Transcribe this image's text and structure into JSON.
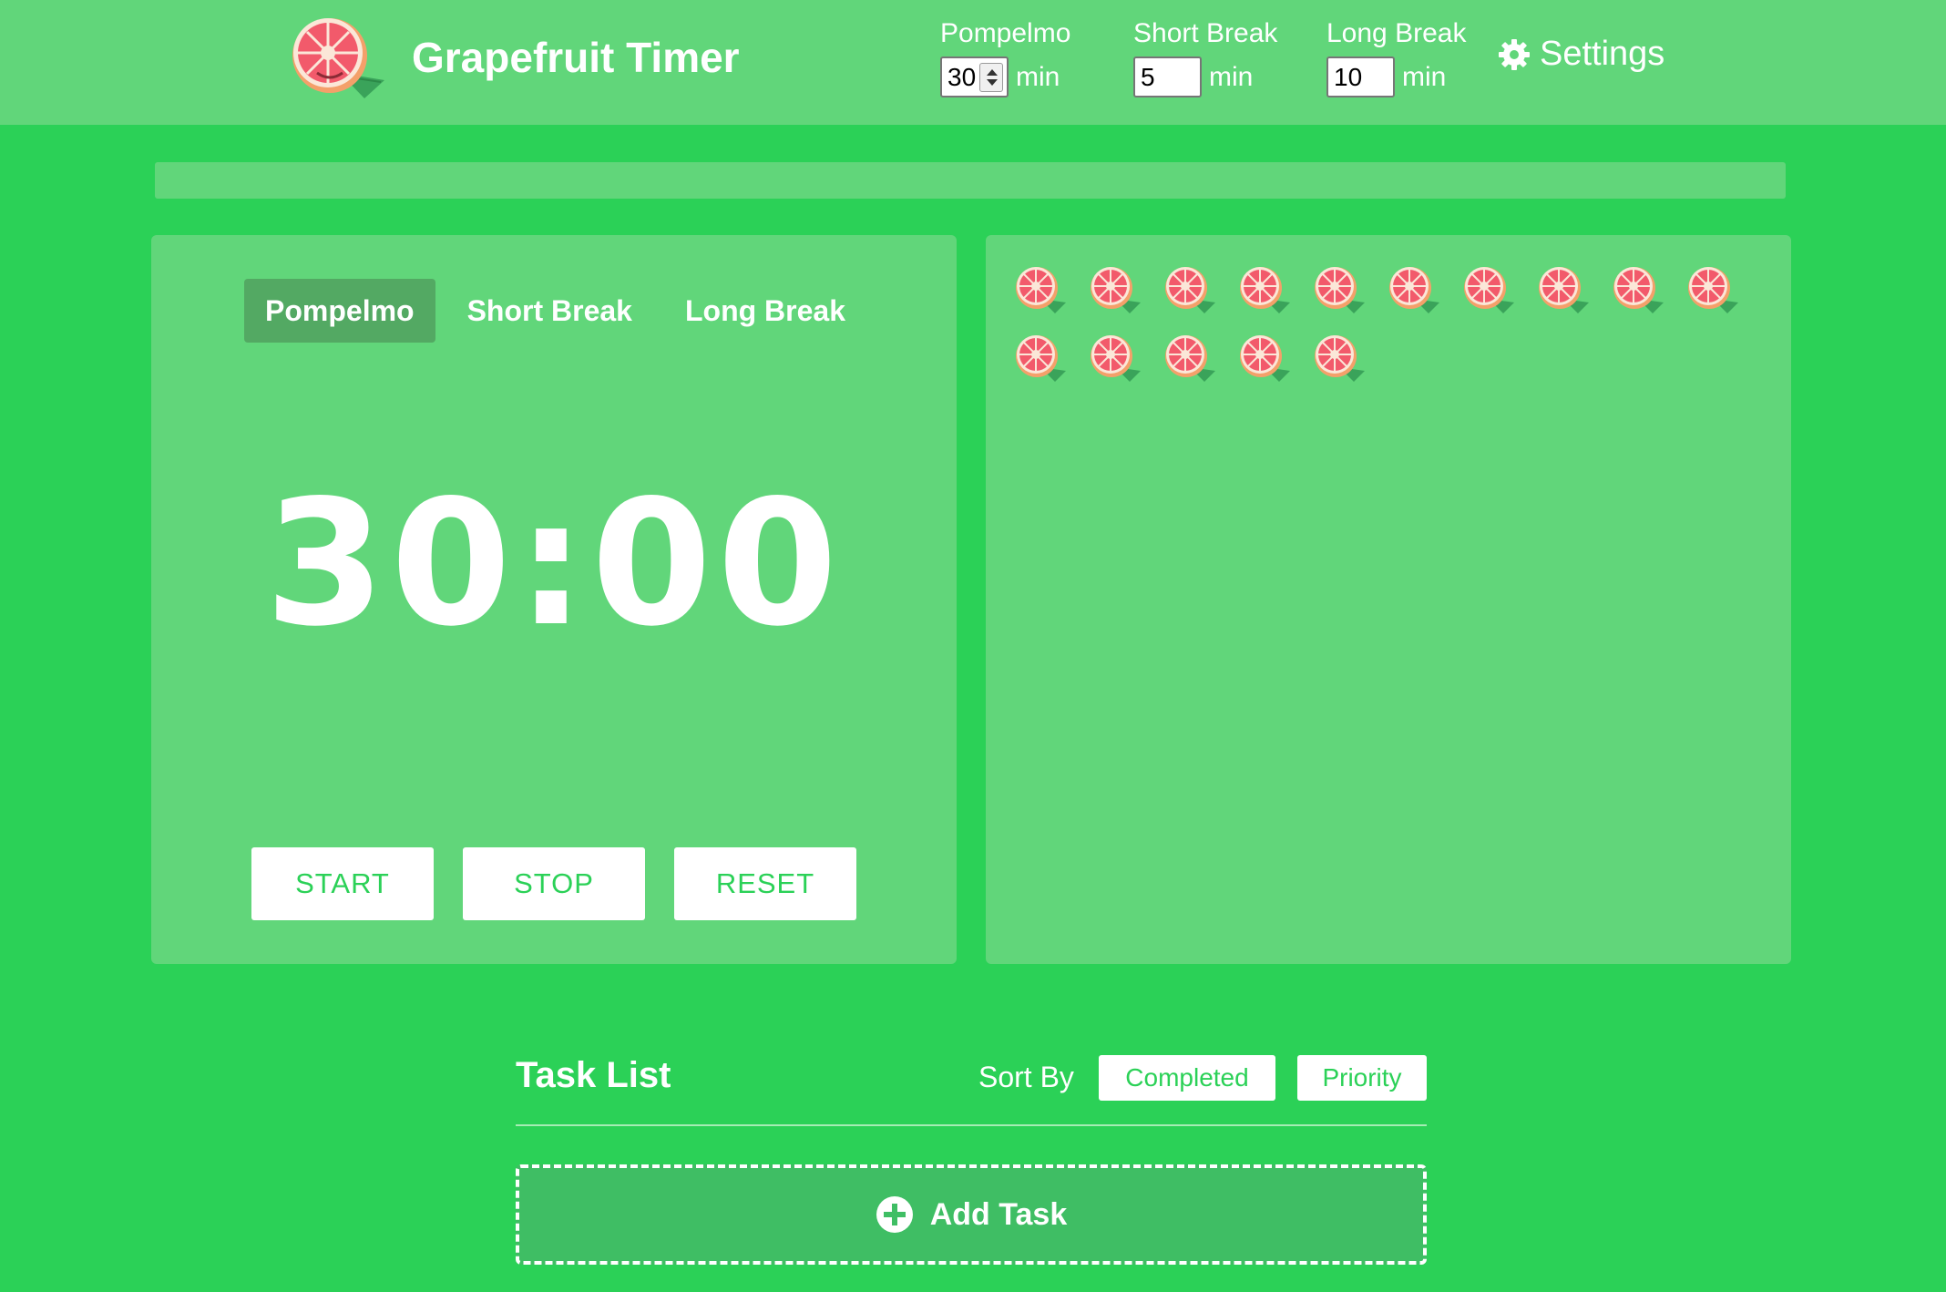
{
  "header": {
    "app_title": "Grapefruit Timer",
    "logo_icon": "grapefruit-icon",
    "durations": [
      {
        "label": "Pompelmo",
        "value": "30",
        "unit": "min"
      },
      {
        "label": "Short Break",
        "value": "5",
        "unit": "min"
      },
      {
        "label": "Long Break",
        "value": "10",
        "unit": "min"
      }
    ],
    "settings_label": "Settings",
    "settings_icon": "gear-icon"
  },
  "progress": {
    "fraction": 0
  },
  "timer": {
    "modes": [
      {
        "label": "Pompelmo",
        "active": true
      },
      {
        "label": "Short Break",
        "active": false
      },
      {
        "label": "Long Break",
        "active": false
      }
    ],
    "time": "30:00",
    "buttons": {
      "start": "START",
      "stop": "STOP",
      "reset": "RESET"
    }
  },
  "sessions": {
    "completed_count": 15,
    "icon": "grapefruit-icon"
  },
  "tasks": {
    "title": "Task List",
    "sort_label": "Sort By",
    "sort_completed": "Completed",
    "sort_priority": "Priority",
    "add_label": "Add Task",
    "add_icon": "plus-circle-icon"
  },
  "colors": {
    "background": "#2bd157",
    "panel": "#61d67a",
    "active_tab": "#53a963",
    "accent_text": "#2bd157",
    "grapefruit": "#f25a6b"
  }
}
